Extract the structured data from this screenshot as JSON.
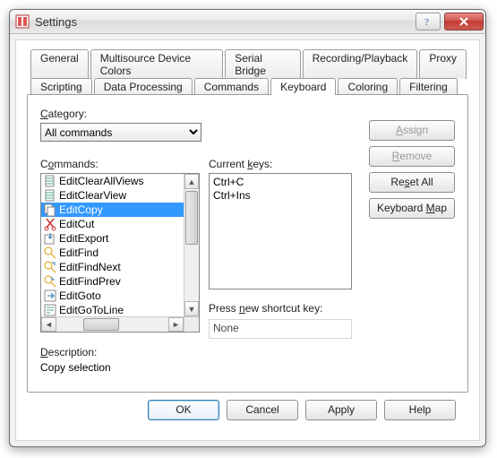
{
  "window": {
    "title": "Settings"
  },
  "tabs": {
    "row1": [
      "General",
      "Multisource Device Colors",
      "Serial Bridge",
      "Recording/Playback",
      "Proxy"
    ],
    "row2": [
      "Scripting",
      "Data Processing",
      "Commands",
      "Keyboard",
      "Coloring",
      "Filtering"
    ],
    "active": "Keyboard"
  },
  "category": {
    "label": "Category:",
    "value": "All commands"
  },
  "commands": {
    "label": "Commands:",
    "items": [
      {
        "id": "EditClearAllViews",
        "label": "EditClearAllViews",
        "icon": "doc"
      },
      {
        "id": "EditClearView",
        "label": "EditClearView",
        "icon": "doc"
      },
      {
        "id": "EditCopy",
        "label": "EditCopy",
        "icon": "copy",
        "selected": true
      },
      {
        "id": "EditCut",
        "label": "EditCut",
        "icon": "cut"
      },
      {
        "id": "EditExport",
        "label": "EditExport",
        "icon": "export"
      },
      {
        "id": "EditFind",
        "label": "EditFind",
        "icon": "find"
      },
      {
        "id": "EditFindNext",
        "label": "EditFindNext",
        "icon": "findnext"
      },
      {
        "id": "EditFindPrev",
        "label": "EditFindPrev",
        "icon": "findprev"
      },
      {
        "id": "EditGoto",
        "label": "EditGoto",
        "icon": "goto"
      },
      {
        "id": "EditGoToLine",
        "label": "EditGoToLine",
        "icon": "gotoline"
      }
    ]
  },
  "currentkeys": {
    "label": "Current keys:",
    "values": [
      "Ctrl+C",
      "Ctrl+Ins"
    ]
  },
  "shortcut": {
    "label": "Press new shortcut key:",
    "value": "None"
  },
  "actions": {
    "assign": "Assign",
    "remove": "Remove",
    "resetall": "Reset All",
    "kbdmap": "Keyboard Map"
  },
  "description": {
    "label": "Description:",
    "text": "Copy selection"
  },
  "footer": {
    "ok": "OK",
    "cancel": "Cancel",
    "apply": "Apply",
    "help": "Help"
  }
}
